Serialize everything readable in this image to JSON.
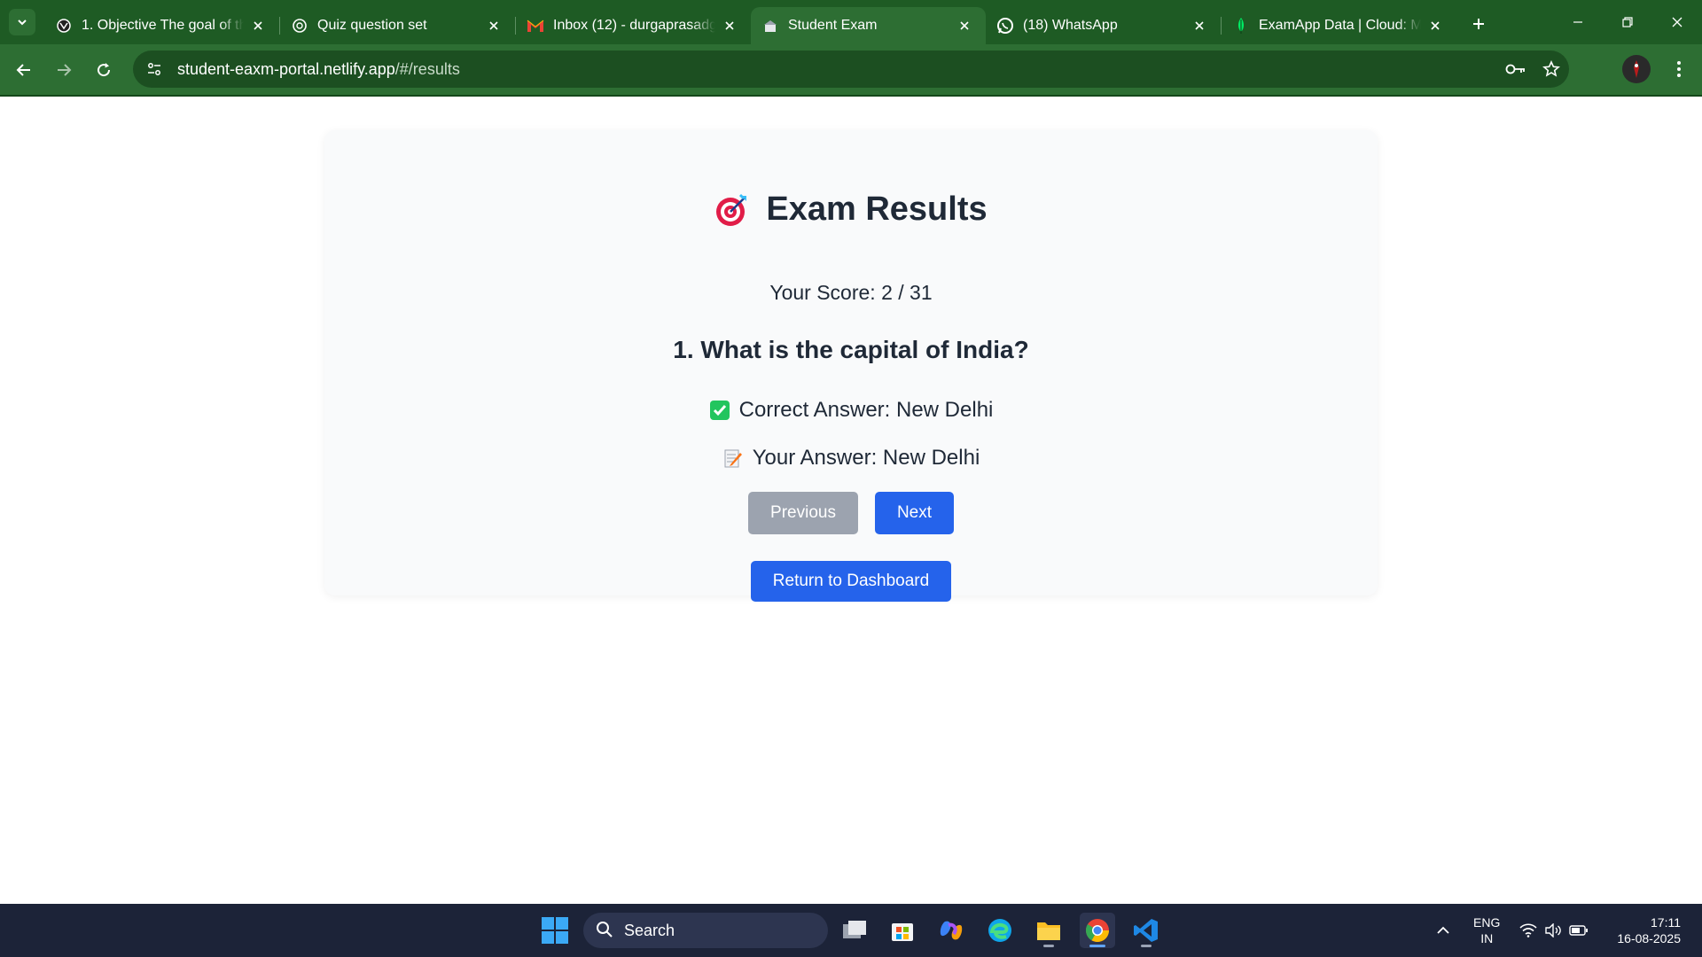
{
  "browser": {
    "tabs": [
      {
        "title": "1. Objective The goal of this",
        "favicon": "objective-icon",
        "active": false
      },
      {
        "title": "Quiz question set",
        "favicon": "chatgpt-icon",
        "active": false
      },
      {
        "title": "Inbox (12) - durgaprasadgu",
        "favicon": "gmail-icon",
        "active": false
      },
      {
        "title": "Student Exam",
        "favicon": "student-exam-icon",
        "active": true
      },
      {
        "title": "(18) WhatsApp",
        "favicon": "whatsapp-icon",
        "active": false
      },
      {
        "title": "ExamApp Data | Cloud: Mo",
        "favicon": "mongodb-leaf-icon",
        "active": false
      }
    ],
    "url_host": "student-eaxm-portal.netlify.app",
    "url_path": "/#/results",
    "accent_color": "#1e5b24"
  },
  "results": {
    "title": "Exam Results",
    "score_text": "Your Score: 2 / 31",
    "question": "1. What is the capital of India?",
    "correct_answer": "Correct Answer: New Delhi",
    "your_answer": "Your Answer: New Delhi",
    "buttons": {
      "previous": "Previous",
      "next": "Next",
      "dashboard": "Return to Dashboard"
    },
    "colors": {
      "primary": "#2563eb",
      "disabled": "#9ca3af"
    }
  },
  "taskbar": {
    "search_placeholder": "Search",
    "language_line1": "ENG",
    "language_line2": "IN",
    "time": "17:11",
    "date": "16-08-2025"
  }
}
